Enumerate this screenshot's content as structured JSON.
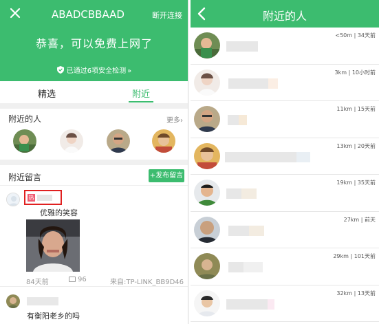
{
  "left": {
    "header": {
      "title": "ABADCBBAAD",
      "disconnect": "断开连接",
      "congrats": "恭喜，可以免费上网了",
      "security": "已通过6项安全检测",
      "security_arrow": "»"
    },
    "tabs": [
      "精选",
      "附近"
    ],
    "nearby": {
      "label": "附近的人",
      "more": "更多",
      "more_arrow": "›"
    },
    "messages": {
      "label": "附近留言",
      "post_button": "+发布留言",
      "post1": {
        "hot": "热",
        "text": "优雅的笑容",
        "time": "84天前",
        "comments": "96",
        "source": "来自:TP-LINK_BB9D46"
      },
      "post2": {
        "text": "有衡阳老乡的吗"
      }
    }
  },
  "right": {
    "title": "附近的人",
    "people": [
      {
        "dist": "<50m | 34天前"
      },
      {
        "dist": "3km | 10小时前"
      },
      {
        "dist": "11km | 15天前"
      },
      {
        "dist": "13km | 20天前"
      },
      {
        "dist": "19km | 35天前"
      },
      {
        "dist": "27km | 前天"
      },
      {
        "dist": "29km | 101天前"
      },
      {
        "dist": "32km | 13天前"
      }
    ]
  },
  "colors": {
    "brand_green": "#3cbc6f",
    "hot_red": "#f05b72",
    "highlight_box": "#e02020"
  },
  "icons": [
    "close-icon",
    "shield-icon",
    "chevron-right-icon",
    "comment-icon",
    "back-icon"
  ]
}
